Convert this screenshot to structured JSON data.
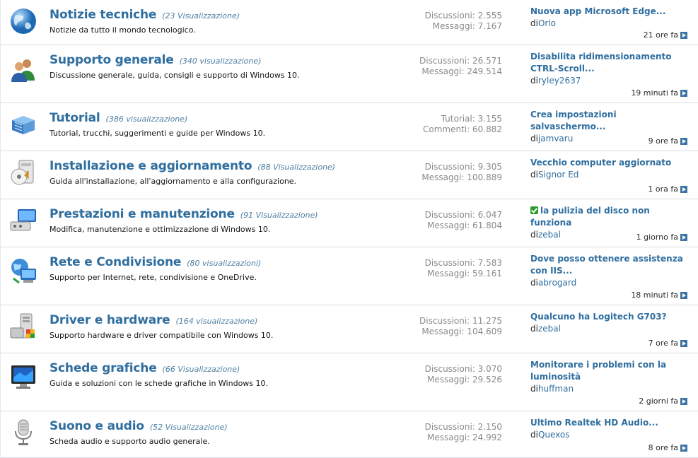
{
  "forums": [
    {
      "title": "Notizie tecniche",
      "views": "(23 Visualizzazione)",
      "desc": "Notizie da tutto il mondo tecnologico.",
      "stat1": "Discussioni: 2.555",
      "stat2": "Messaggi: 7.167",
      "last_title": "Nuova app Microsoft Edge...",
      "by_prefix": "di",
      "by_user": "Orlo",
      "time": "21 ore fa",
      "icon": "globe-icon",
      "solved": false
    },
    {
      "title": "Supporto generale",
      "views": "(340 visualizzazione)",
      "desc": "Discussione generale, guida, consigli e supporto di Windows 10.",
      "stat1": "Discussioni: 26.571",
      "stat2": "Messaggi: 249.514",
      "last_title": "Disabilita ridimensionamento CTRL-Scroll...",
      "by_prefix": "di",
      "by_user": "ryley2637",
      "time": "19 minuti fa",
      "icon": "users-icon",
      "solved": false
    },
    {
      "title": "Tutorial",
      "views": "(386 visualizzazione)",
      "desc": "Tutorial, trucchi, suggerimenti e guide per Windows 10.",
      "stat1": "Tutorial: 3.155",
      "stat2": "Commenti: 60.882",
      "last_title": "Crea impostazioni salvaschermo...",
      "by_prefix": "di",
      "by_user": "jamvaru",
      "time": "9 ore fa",
      "icon": "book-icon",
      "solved": false
    },
    {
      "title": "Installazione e aggiornamento",
      "views": "(88 Visualizzazione)",
      "desc": "Guida all'installazione, all'aggiornamento e alla configurazione.",
      "stat1": "Discussioni: 9.305",
      "stat2": "Messaggi: 100.889",
      "last_title": "Vecchio computer aggiornato",
      "by_prefix": "di",
      "by_user": "Signor Ed",
      "time": "1 ora fa",
      "icon": "install-disc-icon",
      "solved": false
    },
    {
      "title": "Prestazioni e manutenzione",
      "views": "(91 Visualizzazione)",
      "desc": "Modifica, manutenzione e ottimizzazione di Windows 10.",
      "stat1": "Discussioni: 6.047",
      "stat2": "Messaggi: 61.804",
      "last_title": "la pulizia del disco non funziona",
      "by_prefix": "di",
      "by_user": "zebal",
      "time": "1 giorno fa",
      "icon": "computer-maintenance-icon",
      "solved": true
    },
    {
      "title": "Rete e Condivisione",
      "views": "(80 visualizzazioni)",
      "desc": "Supporto per Internet, rete, condivisione e OneDrive.",
      "stat1": "Discussioni: 7.583",
      "stat2": "Messaggi: 59.161",
      "last_title": "Dove posso ottenere assistenza con IIS...",
      "by_prefix": "di",
      "by_user": "abrogard",
      "time": "18 minuti fa",
      "icon": "network-globe-icon",
      "solved": false
    },
    {
      "title": "Driver e hardware",
      "views": "(164 visualizzazione)",
      "desc": "Supporto hardware e driver compatibile con Windows 10.",
      "stat1": "Discussioni: 11.275",
      "stat2": "Messaggi: 104.609",
      "last_title": "Qualcuno ha Logitech G703?",
      "by_prefix": "di",
      "by_user": "zebal",
      "time": "7 ore fa",
      "icon": "hardware-tower-icon",
      "solved": false
    },
    {
      "title": "Schede grafiche",
      "views": "(66 Visualizzazione)",
      "desc": "Guida e soluzioni con le schede grafiche in Windows 10.",
      "stat1": "Discussioni: 3.070",
      "stat2": "Messaggi: 29.526",
      "last_title": "Monitorare i problemi con la luminosità",
      "by_prefix": "di",
      "by_user": "huffman",
      "time": "2 giorni fa",
      "icon": "monitor-icon",
      "solved": false
    },
    {
      "title": "Suono e audio",
      "views": "(52 Visualizzazione)",
      "desc": "Scheda audio e supporto audio generale.",
      "stat1": "Discussioni: 2.150",
      "stat2": "Messaggi: 24.992",
      "last_title": "Ultimo Realtek HD Audio...",
      "by_prefix": "di",
      "by_user": "Quexos",
      "time": "8 ore fa",
      "icon": "microphone-icon",
      "solved": false
    }
  ],
  "colors": {
    "link": "#2f6e9f",
    "stats": "#8a8a8a",
    "solved": "#2e9b2e"
  }
}
